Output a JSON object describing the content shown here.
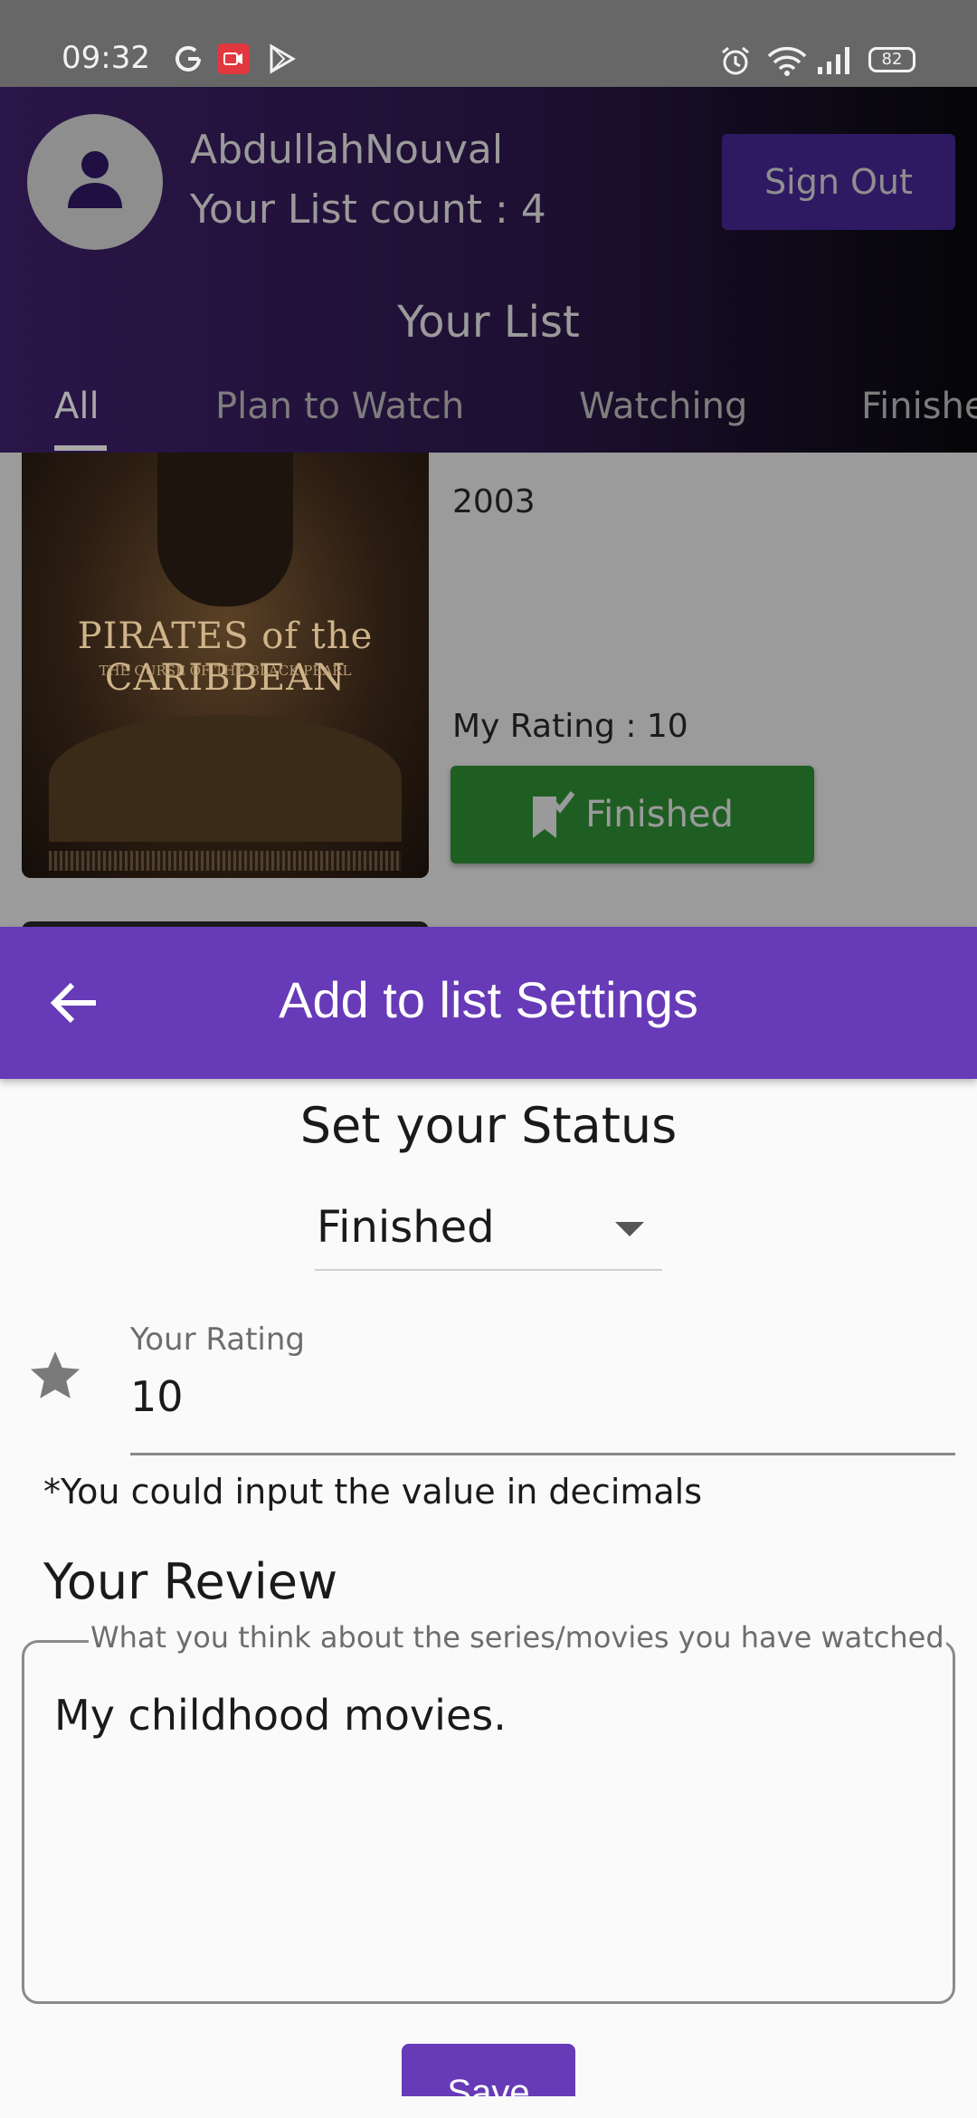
{
  "status_bar": {
    "time": "09:32",
    "left_icons": [
      "google-icon",
      "screen-record-icon",
      "play-store-icon"
    ],
    "right_icons": [
      "alarm-icon",
      "wifi-icon",
      "signal-icon"
    ],
    "battery": "82"
  },
  "header": {
    "user_name": "AbdullahNouval",
    "list_count": "Your List count : 4",
    "sign_out_label": "Sign Out",
    "title": "Your List",
    "tabs": [
      {
        "label": "All",
        "active": true
      },
      {
        "label": "Plan to Watch",
        "active": false
      },
      {
        "label": "Watching",
        "active": false
      },
      {
        "label": "Finished",
        "active": false
      }
    ]
  },
  "list_item": {
    "poster_title": "PIRATES of the CARIBBEAN",
    "poster_subtitle": "THE CURSE OF THE BLACK PEARL",
    "year": "2003",
    "my_rating": "My Rating : 10",
    "status_button_label": "Finished"
  },
  "sheet": {
    "title": "Add to list Settings",
    "status_label": "Set your Status",
    "status_value": "Finished",
    "rating_label": "Your Rating",
    "rating_value": "10",
    "rating_hint": "*You could input the value in decimals",
    "review_title": "Your Review",
    "review_placeholder": "What you think about the series/movies you have watched",
    "review_text": "My childhood movies.",
    "save_label": "Save"
  },
  "colors": {
    "accent": "#673ab7",
    "finished_green": "#1f5e23",
    "header_dark": "#2a1548"
  }
}
